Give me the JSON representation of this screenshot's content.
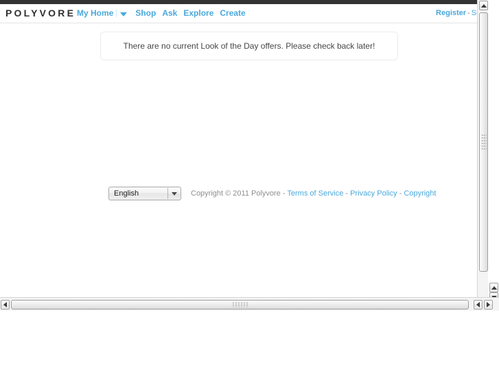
{
  "browser": {
    "vertical_scrollbar": {
      "name": "vertical-scrollbar",
      "up_arrow": "▲",
      "down_arrow": "▼"
    },
    "horizontal_scrollbar": {
      "name": "horizontal-scrollbar",
      "left_arrow": "◀",
      "right_arrow": "▶"
    }
  },
  "header": {
    "logo": "POLYVORE",
    "nav": [
      {
        "label": "My Home",
        "has_caret": true
      },
      {
        "label": "Shop",
        "has_caret": false
      },
      {
        "label": "Ask",
        "has_caret": false
      },
      {
        "label": "Explore",
        "has_caret": false
      },
      {
        "label": "Create",
        "has_caret": false
      }
    ],
    "auth": {
      "register": "Register",
      "separator": "-",
      "signin": "Sign In"
    }
  },
  "main": {
    "notice": "There are no current Look of the Day offers. Please check back later!"
  },
  "footer": {
    "language": {
      "selected": "English",
      "options": [
        "English"
      ]
    },
    "copyright": "Copyright © 2011 Polyvore",
    "sep1": "-",
    "links": [
      {
        "label": "Terms of Service"
      },
      {
        "label": "Privacy Policy"
      },
      {
        "label": "Copyright"
      }
    ],
    "link_sep": "-"
  },
  "colors": {
    "accent_blue": "#49a8db",
    "dark_bar": "#333333",
    "text_gray": "#8e8e8e",
    "notice_text": "#464646"
  }
}
